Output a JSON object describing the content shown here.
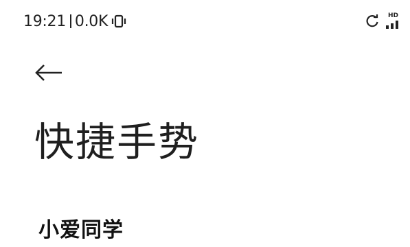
{
  "status_bar": {
    "time": "19:21",
    "network_speed": "0.0K",
    "vibrate_icon": "vibrate-icon",
    "sync_icon": "sync-icon",
    "hd_label": "HD",
    "signal_icon": "signal-bars-icon"
  },
  "navigation": {
    "back_icon": "back-arrow-icon"
  },
  "page": {
    "title": "快捷手势"
  },
  "sections": [
    {
      "label": "小爱同学"
    }
  ]
}
